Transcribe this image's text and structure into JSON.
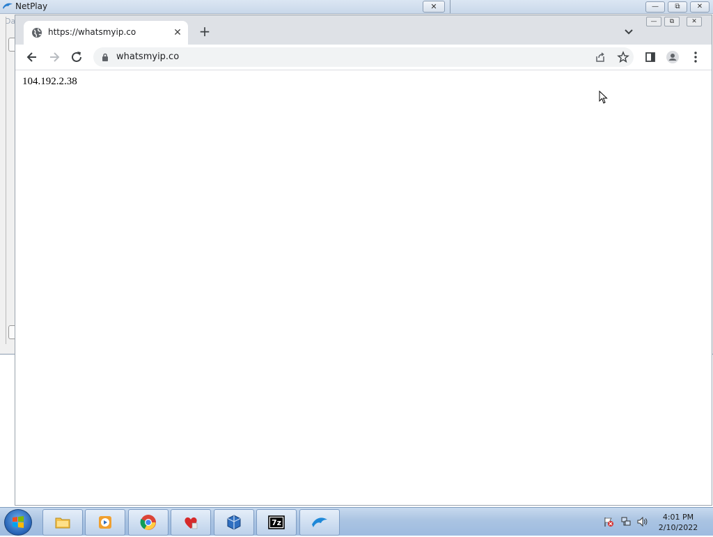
{
  "background_window": {
    "title": "NetPlay",
    "side_label": "Da",
    "close_symbol": "✕",
    "minimize_symbol": "—",
    "restore_symbol": "⧉"
  },
  "browser": {
    "tab": {
      "title": "https://whatsmyip.co",
      "close_symbol": "✕"
    },
    "new_tab_symbol": "+",
    "address_bar": {
      "url": "whatsmyip.co"
    },
    "window_controls": {
      "minimize": "—",
      "restore": "⧉",
      "close": "✕"
    }
  },
  "page": {
    "ip_address": "104.192.2.38"
  },
  "taskbar": {
    "pinned": [
      {
        "name": "file-explorer"
      },
      {
        "name": "media-player"
      },
      {
        "name": "chrome"
      },
      {
        "name": "heart-app"
      },
      {
        "name": "virtualbox"
      },
      {
        "name": "7zip"
      },
      {
        "name": "dolphin"
      }
    ],
    "clock": {
      "time": "4:01 PM",
      "date": "2/10/2022"
    }
  },
  "colors": {
    "tabstrip": "#dee1e6",
    "omnibox": "#f1f3f4",
    "taskbar": "#aac4e2",
    "dolphin_blue": "#1e88d8"
  }
}
